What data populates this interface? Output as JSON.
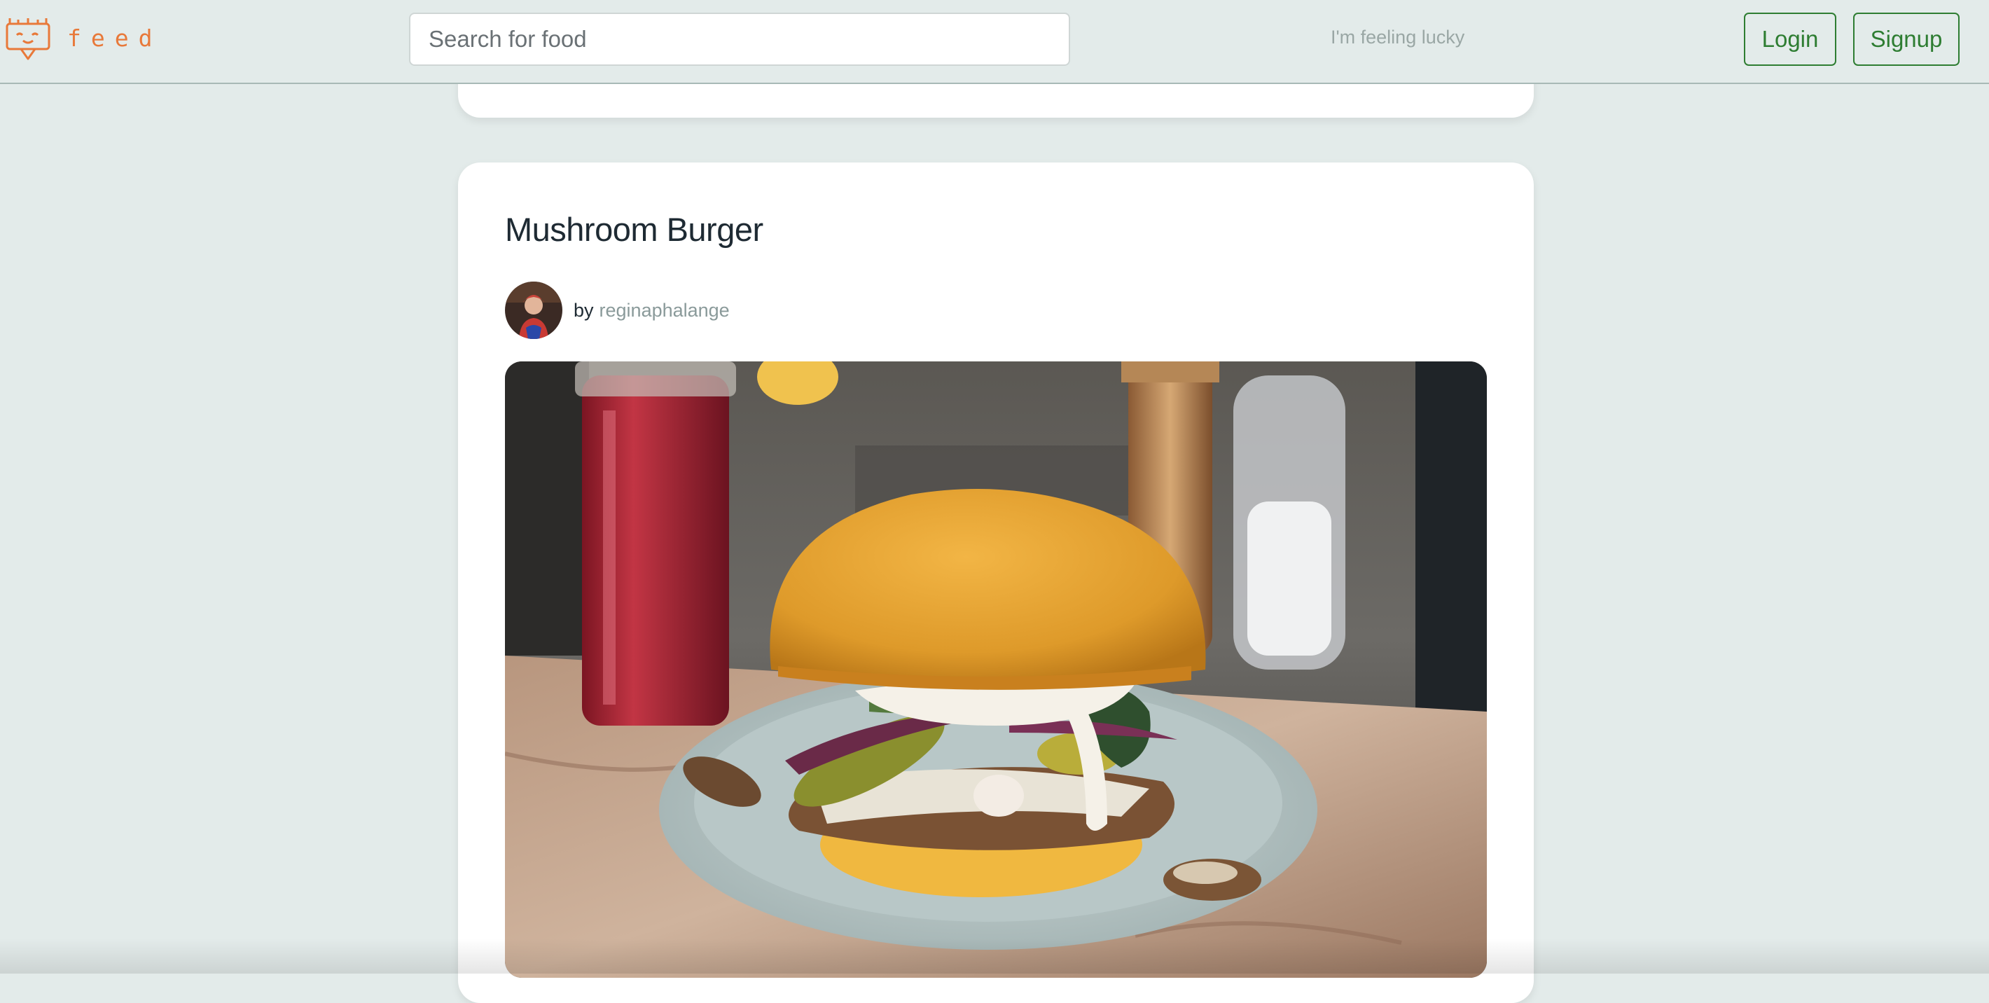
{
  "header": {
    "brand_name": "feed",
    "search": {
      "placeholder": "Search for food",
      "value": ""
    },
    "lucky_label": "I'm feeling lucky",
    "login_label": "Login",
    "signup_label": "Signup"
  },
  "post": {
    "title": "Mushroom Burger",
    "by_label": "by",
    "author": "reginaphalange",
    "image_icon": "photo-mushroom-burger"
  },
  "colors": {
    "background": "#e3ebea",
    "brand_orange": "#e8793a",
    "button_green": "#2e7d32",
    "muted_link": "#8a9a9a"
  }
}
